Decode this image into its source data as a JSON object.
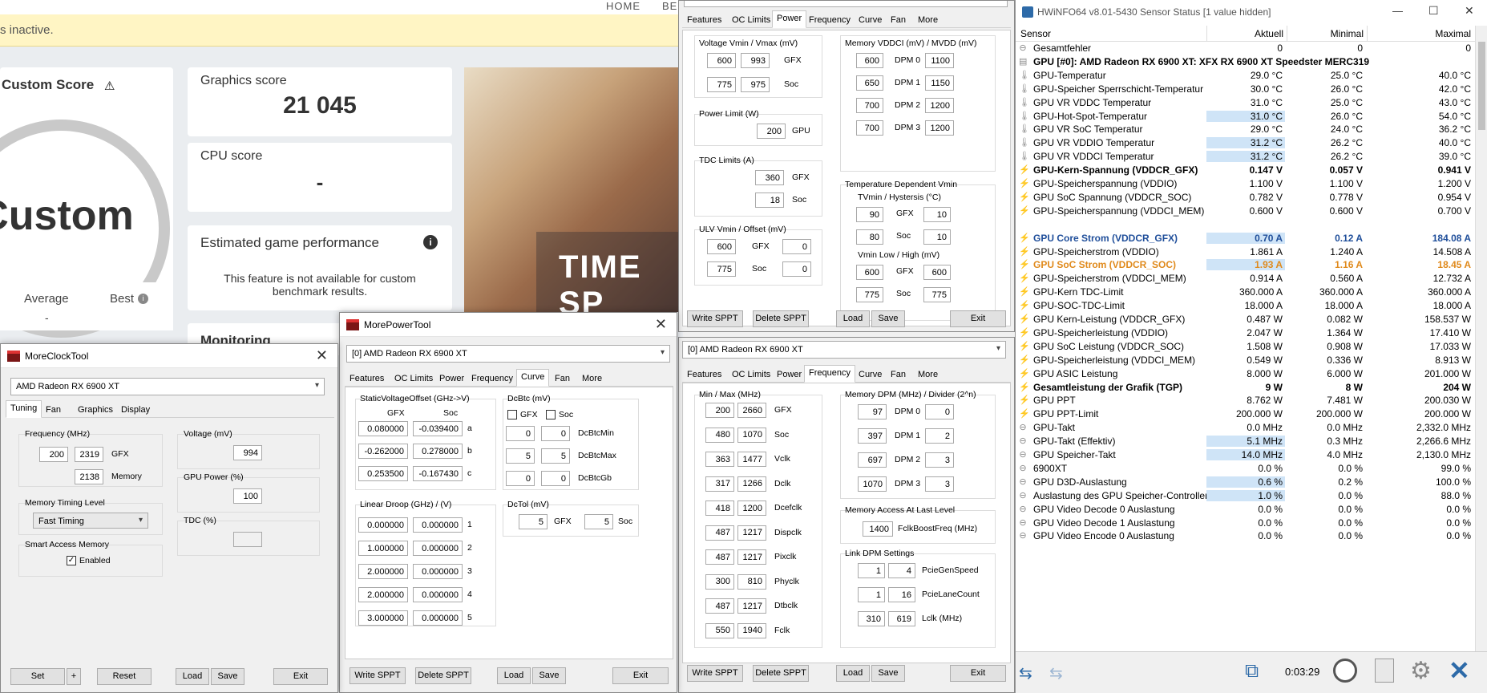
{
  "threedmark": {
    "nav": [
      "HOME",
      "BE"
    ],
    "banner": "s inactive.",
    "custom_score_title": "Custom Score",
    "custom_big": "Custom",
    "graphics_label": "Graphics score",
    "graphics_value": "21 045",
    "cpu_label": "CPU score",
    "cpu_value": "-",
    "est_title": "Estimated game performance",
    "est_text": "This feature is not available for custom benchmark results.",
    "average": "Average",
    "average_val": "-",
    "best": "Best",
    "monitoring": "Monitoring",
    "art_text": "TIME SP"
  },
  "mpt_top": {
    "tabs": [
      "Features",
      "OC Limits",
      "Power",
      "Frequency",
      "Curve",
      "Fan",
      "More"
    ],
    "active_tab": "Power",
    "voltage_title": "Voltage Vmin / Vmax (mV)",
    "v_gfx": [
      "600",
      "993"
    ],
    "v_gfx_lab": "GFX",
    "v_soc": [
      "775",
      "975"
    ],
    "v_soc_lab": "Soc",
    "power_title": "Power Limit (W)",
    "power_val": "200",
    "power_lab": "GPU",
    "tdc_title": "TDC Limits (A)",
    "tdc_gfx": "360",
    "tdc_gfx_lab": "GFX",
    "tdc_soc": "18",
    "tdc_soc_lab": "Soc",
    "ulv_title": "ULV Vmin / Offset (mV)",
    "ulv_gfx": [
      "600",
      "0"
    ],
    "ulv_gfx_lab": "GFX",
    "ulv_soc": [
      "775",
      "0"
    ],
    "ulv_soc_lab": "Soc",
    "mem_title": "Memory VDDCI (mV) / MVDD (mV)",
    "mem_rows": [
      {
        "a": "600",
        "l": "DPM 0",
        "b": "1100"
      },
      {
        "a": "650",
        "l": "DPM 1",
        "b": "1150"
      },
      {
        "a": "700",
        "l": "DPM 2",
        "b": "1200"
      },
      {
        "a": "700",
        "l": "DPM 3",
        "b": "1200"
      }
    ],
    "temp_title": "Temperature Dependent Vmin",
    "temp_sub": "TVmin / Hystersis (°C)",
    "t_gfx": [
      "90",
      "10"
    ],
    "t_gfx_lab": "GFX",
    "t_soc": [
      "80",
      "10"
    ],
    "t_soc_lab": "Soc",
    "vmin_title": "Vmin Low / High (mV)",
    "vm_gfx": [
      "600",
      "600"
    ],
    "vm_gfx_lab": "GFX",
    "vm_soc": [
      "775",
      "775"
    ],
    "vm_soc_lab": "Soc",
    "buttons": {
      "write": "Write SPPT",
      "delete": "Delete SPPT",
      "load": "Load",
      "save": "Save",
      "exit": "Exit"
    }
  },
  "mpt_freq": {
    "device": "[0] AMD Radeon RX 6900 XT",
    "tabs": [
      "Features",
      "OC Limits",
      "Power",
      "Frequency",
      "Curve",
      "Fan",
      "More"
    ],
    "active_tab": "Frequency",
    "minmax_title": "Min / Max (MHz)",
    "rows": [
      {
        "a": "200",
        "b": "2660",
        "l": "GFX"
      },
      {
        "a": "480",
        "b": "1070",
        "l": "Soc"
      },
      {
        "a": "363",
        "b": "1477",
        "l": "Vclk"
      },
      {
        "a": "317",
        "b": "1266",
        "l": "Dclk"
      },
      {
        "a": "418",
        "b": "1200",
        "l": "Dcefclk"
      },
      {
        "a": "487",
        "b": "1217",
        "l": "Dispclk"
      },
      {
        "a": "487",
        "b": "1217",
        "l": "Pixclk"
      },
      {
        "a": "300",
        "b": "810",
        "l": "Phyclk"
      },
      {
        "a": "487",
        "b": "1217",
        "l": "Dtbclk"
      },
      {
        "a": "550",
        "b": "1940",
        "l": "Fclk"
      }
    ],
    "memdpm_title": "Memory DPM (MHz) / Divider (2^n)",
    "memdpm": [
      {
        "a": "97",
        "l": "DPM 0",
        "b": "0"
      },
      {
        "a": "397",
        "l": "DPM 1",
        "b": "2"
      },
      {
        "a": "697",
        "l": "DPM 2",
        "b": "3"
      },
      {
        "a": "1070",
        "l": "DPM 3",
        "b": "3"
      }
    ],
    "memaccess_title": "Memory Access At Last Level",
    "fclk_val": "1400",
    "fclk_lab": "FclkBoostFreq (MHz)",
    "link_title": "Link DPM Settings",
    "link": [
      {
        "a": "1",
        "b": "4",
        "l": "PcieGenSpeed"
      },
      {
        "a": "1",
        "b": "16",
        "l": "PcieLaneCount"
      },
      {
        "a": "310",
        "b": "619",
        "l": "Lclk (MHz)"
      }
    ],
    "buttons": {
      "write": "Write SPPT",
      "delete": "Delete SPPT",
      "load": "Load",
      "save": "Save",
      "exit": "Exit"
    }
  },
  "mpt_curve": {
    "title": "MorePowerTool",
    "close": "✕",
    "device": "[0] AMD Radeon RX 6900 XT",
    "tabs": [
      "Features",
      "OC Limits",
      "Power",
      "Frequency",
      "Curve",
      "Fan",
      "More"
    ],
    "active_tab": "Curve",
    "svo_title": "StaticVoltageOffset (GHz->V)",
    "col_gfx": "GFX",
    "col_soc": "Soc",
    "svo": [
      {
        "g": "0.080000",
        "s": "-0.039400",
        "l": "a"
      },
      {
        "g": "-0.262000",
        "s": "0.278000",
        "l": "b"
      },
      {
        "g": "0.253500",
        "s": "-0.167430",
        "l": "c"
      }
    ],
    "droop_title": "Linear Droop (GHz) / (V)",
    "droop": [
      {
        "a": "0.000000",
        "b": "0.000000",
        "l": "1"
      },
      {
        "a": "1.000000",
        "b": "0.000000",
        "l": "2"
      },
      {
        "a": "2.000000",
        "b": "0.000000",
        "l": "3"
      },
      {
        "a": "2.000000",
        "b": "0.000000",
        "l": "4"
      },
      {
        "a": "3.000000",
        "b": "0.000000",
        "l": "5"
      }
    ],
    "dcbtc_title": "DcBtc (mV)",
    "chk_gfx": "GFX",
    "chk_soc": "Soc",
    "dcbtc": [
      {
        "a": "0",
        "b": "0",
        "l": "DcBtcMin"
      },
      {
        "a": "5",
        "b": "5",
        "l": "DcBtcMax"
      },
      {
        "a": "0",
        "b": "0",
        "l": "DcBtcGb"
      }
    ],
    "dctol_title": "DcTol (mV)",
    "dctol_gfx": "5",
    "dctol_gfx_lab": "GFX",
    "dctol_soc": "5",
    "dctol_soc_lab": "Soc",
    "buttons": {
      "write": "Write SPPT",
      "delete": "Delete SPPT",
      "load": "Load",
      "save": "Save",
      "exit": "Exit"
    }
  },
  "mct": {
    "title": "MoreClockTool",
    "close": "✕",
    "device": "AMD Radeon RX 6900 XT",
    "tabs": [
      "Tuning",
      "Fan",
      "Graphics",
      "Display"
    ],
    "active_tab": "Tuning",
    "freq_title": "Frequency (MHz)",
    "f_min": "200",
    "f_gfx": "2319",
    "f_gfx_lab": "GFX",
    "f_mem": "2138",
    "f_mem_lab": "Memory",
    "volt_title": "Voltage (mV)",
    "volt_val": "994",
    "gpupower_title": "GPU Power (%)",
    "gpupower_val": "100",
    "tdc_title": "TDC (%)",
    "tdc_val": "",
    "memtiming_title": "Memory Timing Level",
    "memtiming_val": "Fast Timing",
    "sam_title": "Smart Access Memory",
    "sam_label": "Enabled",
    "sam_check": "✓",
    "buttons": {
      "set": "Set",
      "plus": "+",
      "reset": "Reset",
      "load": "Load",
      "save": "Save",
      "exit": "Exit"
    }
  },
  "hwinfo": {
    "title": "HWiNFO64 v8.01-5430 Sensor Status [1 value hidden]",
    "win_controls": [
      "—",
      "☐",
      "✕"
    ],
    "cols": [
      "Sensor",
      "Aktuell",
      "Minimal",
      "Maximal"
    ],
    "rows": [
      {
        "n": "Gesamtfehler",
        "c": "0",
        "mi": "0",
        "ma": "0",
        "ic": "minus",
        "b": false,
        "hl": false,
        "col": ""
      },
      {
        "n": "GPU [#0]: AMD Radeon RX 6900 XT: XFX RX 6900 XT Speedster MERC319",
        "c": "",
        "mi": "",
        "ma": "",
        "ic": "chip",
        "b": true,
        "hl": false,
        "col": ""
      },
      {
        "n": "GPU-Temperatur",
        "c": "29.0 °C",
        "mi": "25.0 °C",
        "ma": "40.0 °C",
        "ic": "therm",
        "b": false,
        "hl": false,
        "col": ""
      },
      {
        "n": "GPU-Speicher Sperrschicht-Temperatur",
        "c": "30.0 °C",
        "mi": "26.0 °C",
        "ma": "42.0 °C",
        "ic": "therm",
        "b": false,
        "hl": false,
        "col": ""
      },
      {
        "n": "GPU VR VDDC Temperatur",
        "c": "31.0 °C",
        "mi": "25.0 °C",
        "ma": "43.0 °C",
        "ic": "therm",
        "b": false,
        "hl": false,
        "col": ""
      },
      {
        "n": "GPU-Hot-Spot-Temperatur",
        "c": "31.0 °C",
        "mi": "26.0 °C",
        "ma": "54.0 °C",
        "ic": "therm",
        "b": false,
        "hl": true,
        "col": ""
      },
      {
        "n": "GPU VR SoC Temperatur",
        "c": "29.0 °C",
        "mi": "24.0 °C",
        "ma": "36.2 °C",
        "ic": "therm",
        "b": false,
        "hl": false,
        "col": ""
      },
      {
        "n": "GPU VR VDDIO Temperatur",
        "c": "31.2 °C",
        "mi": "26.2 °C",
        "ma": "40.0 °C",
        "ic": "therm",
        "b": false,
        "hl": true,
        "col": ""
      },
      {
        "n": "GPU VR VDDCI Temperatur",
        "c": "31.2 °C",
        "mi": "26.2 °C",
        "ma": "39.0 °C",
        "ic": "therm",
        "b": false,
        "hl": true,
        "col": ""
      },
      {
        "n": "GPU-Kern-Spannung (VDDCR_GFX)",
        "c": "0.147 V",
        "mi": "0.057 V",
        "ma": "0.941 V",
        "ic": "bolt",
        "b": true,
        "hl": false,
        "col": ""
      },
      {
        "n": "GPU-Speicherspannung (VDDIO)",
        "c": "1.100 V",
        "mi": "1.100 V",
        "ma": "1.200 V",
        "ic": "bolt",
        "b": false,
        "hl": false,
        "col": ""
      },
      {
        "n": "GPU SoC Spannung (VDDCR_SOC)",
        "c": "0.782 V",
        "mi": "0.778 V",
        "ma": "0.954 V",
        "ic": "bolt",
        "b": false,
        "hl": false,
        "col": ""
      },
      {
        "n": "GPU-Speicherspannung (VDDCI_MEM)",
        "c": "0.600 V",
        "mi": "0.600 V",
        "ma": "0.700 V",
        "ic": "bolt",
        "b": false,
        "hl": false,
        "col": ""
      },
      {
        "n": "",
        "c": "",
        "mi": "",
        "ma": "",
        "ic": "none",
        "b": false,
        "hl": false,
        "col": ""
      },
      {
        "n": "GPU Core Strom (VDDCR_GFX)",
        "c": "0.70 A",
        "mi": "0.12 A",
        "ma": "184.08 A",
        "ic": "bolt",
        "b": true,
        "hl": true,
        "col": "#1f4e9a"
      },
      {
        "n": "GPU-Speicherstrom (VDDIO)",
        "c": "1.861 A",
        "mi": "1.240 A",
        "ma": "14.508 A",
        "ic": "bolt",
        "b": false,
        "hl": false,
        "col": ""
      },
      {
        "n": "GPU SoC Strom (VDDCR_SOC)",
        "c": "1.93 A",
        "mi": "1.16 A",
        "ma": "18.45 A",
        "ic": "bolt",
        "b": true,
        "hl": true,
        "col": "#e08a1c"
      },
      {
        "n": "GPU-Speicherstrom (VDDCI_MEM)",
        "c": "0.914 A",
        "mi": "0.560 A",
        "ma": "12.732 A",
        "ic": "bolt",
        "b": false,
        "hl": false,
        "col": ""
      },
      {
        "n": "GPU-Kern TDC-Limit",
        "c": "360.000 A",
        "mi": "360.000 A",
        "ma": "360.000 A",
        "ic": "bolt",
        "b": false,
        "hl": false,
        "col": ""
      },
      {
        "n": "GPU-SOC-TDC-Limit",
        "c": "18.000 A",
        "mi": "18.000 A",
        "ma": "18.000 A",
        "ic": "bolt",
        "b": false,
        "hl": false,
        "col": ""
      },
      {
        "n": "GPU Kern-Leistung (VDDCR_GFX)",
        "c": "0.487 W",
        "mi": "0.082 W",
        "ma": "158.537 W",
        "ic": "bolt",
        "b": false,
        "hl": false,
        "col": ""
      },
      {
        "n": "GPU-Speicherleistung (VDDIO)",
        "c": "2.047 W",
        "mi": "1.364 W",
        "ma": "17.410 W",
        "ic": "bolt",
        "b": false,
        "hl": false,
        "col": ""
      },
      {
        "n": "GPU SoC Leistung (VDDCR_SOC)",
        "c": "1.508 W",
        "mi": "0.908 W",
        "ma": "17.033 W",
        "ic": "bolt",
        "b": false,
        "hl": false,
        "col": ""
      },
      {
        "n": "GPU-Speicherleistung (VDDCI_MEM)",
        "c": "0.549 W",
        "mi": "0.336 W",
        "ma": "8.913 W",
        "ic": "bolt",
        "b": false,
        "hl": false,
        "col": ""
      },
      {
        "n": "GPU ASIC Leistung",
        "c": "8.000 W",
        "mi": "6.000 W",
        "ma": "201.000 W",
        "ic": "bolt",
        "b": false,
        "hl": false,
        "col": ""
      },
      {
        "n": "Gesamtleistung der Grafik (TGP)",
        "c": "9 W",
        "mi": "8 W",
        "ma": "204 W",
        "ic": "bolt",
        "b": true,
        "hl": false,
        "col": ""
      },
      {
        "n": "GPU PPT",
        "c": "8.762 W",
        "mi": "7.481 W",
        "ma": "200.030 W",
        "ic": "bolt",
        "b": false,
        "hl": false,
        "col": ""
      },
      {
        "n": "GPU PPT-Limit",
        "c": "200.000 W",
        "mi": "200.000 W",
        "ma": "200.000 W",
        "ic": "bolt",
        "b": false,
        "hl": false,
        "col": ""
      },
      {
        "n": "GPU-Takt",
        "c": "0.0 MHz",
        "mi": "0.0 MHz",
        "ma": "2,332.0 MHz",
        "ic": "minus",
        "b": false,
        "hl": false,
        "col": ""
      },
      {
        "n": "GPU-Takt (Effektiv)",
        "c": "5.1 MHz",
        "mi": "0.3 MHz",
        "ma": "2,266.6 MHz",
        "ic": "minus",
        "b": false,
        "hl": true,
        "col": ""
      },
      {
        "n": "GPU Speicher-Takt",
        "c": "14.0 MHz",
        "mi": "4.0 MHz",
        "ma": "2,130.0 MHz",
        "ic": "minus",
        "b": false,
        "hl": true,
        "col": ""
      },
      {
        "n": "6900XT",
        "c": "0.0 %",
        "mi": "0.0 %",
        "ma": "99.0 %",
        "ic": "minus",
        "b": false,
        "hl": false,
        "col": ""
      },
      {
        "n": "GPU D3D-Auslastung",
        "c": "0.6 %",
        "mi": "0.2 %",
        "ma": "100.0 %",
        "ic": "minus",
        "b": false,
        "hl": true,
        "col": ""
      },
      {
        "n": "Auslastung des GPU Speicher-Controllers",
        "c": "1.0 %",
        "mi": "0.0 %",
        "ma": "88.0 %",
        "ic": "minus",
        "b": false,
        "hl": true,
        "col": ""
      },
      {
        "n": "GPU Video Decode 0 Auslastung",
        "c": "0.0 %",
        "mi": "0.0 %",
        "ma": "0.0 %",
        "ic": "minus",
        "b": false,
        "hl": false,
        "col": ""
      },
      {
        "n": "GPU Video Decode 1 Auslastung",
        "c": "0.0 %",
        "mi": "0.0 %",
        "ma": "0.0 %",
        "ic": "minus",
        "b": false,
        "hl": false,
        "col": ""
      },
      {
        "n": "GPU Video Encode 0 Auslastung",
        "c": "0.0 %",
        "mi": "0.0 %",
        "ma": "0.0 %",
        "ic": "minus",
        "b": false,
        "hl": false,
        "col": ""
      }
    ],
    "timer": "0:03:29",
    "icons": [
      "nav-arrows-icon",
      "nav-arrows-disabled-icon",
      "network-icon",
      "clock-icon",
      "report-icon",
      "settings-icon",
      "close-icon"
    ]
  }
}
